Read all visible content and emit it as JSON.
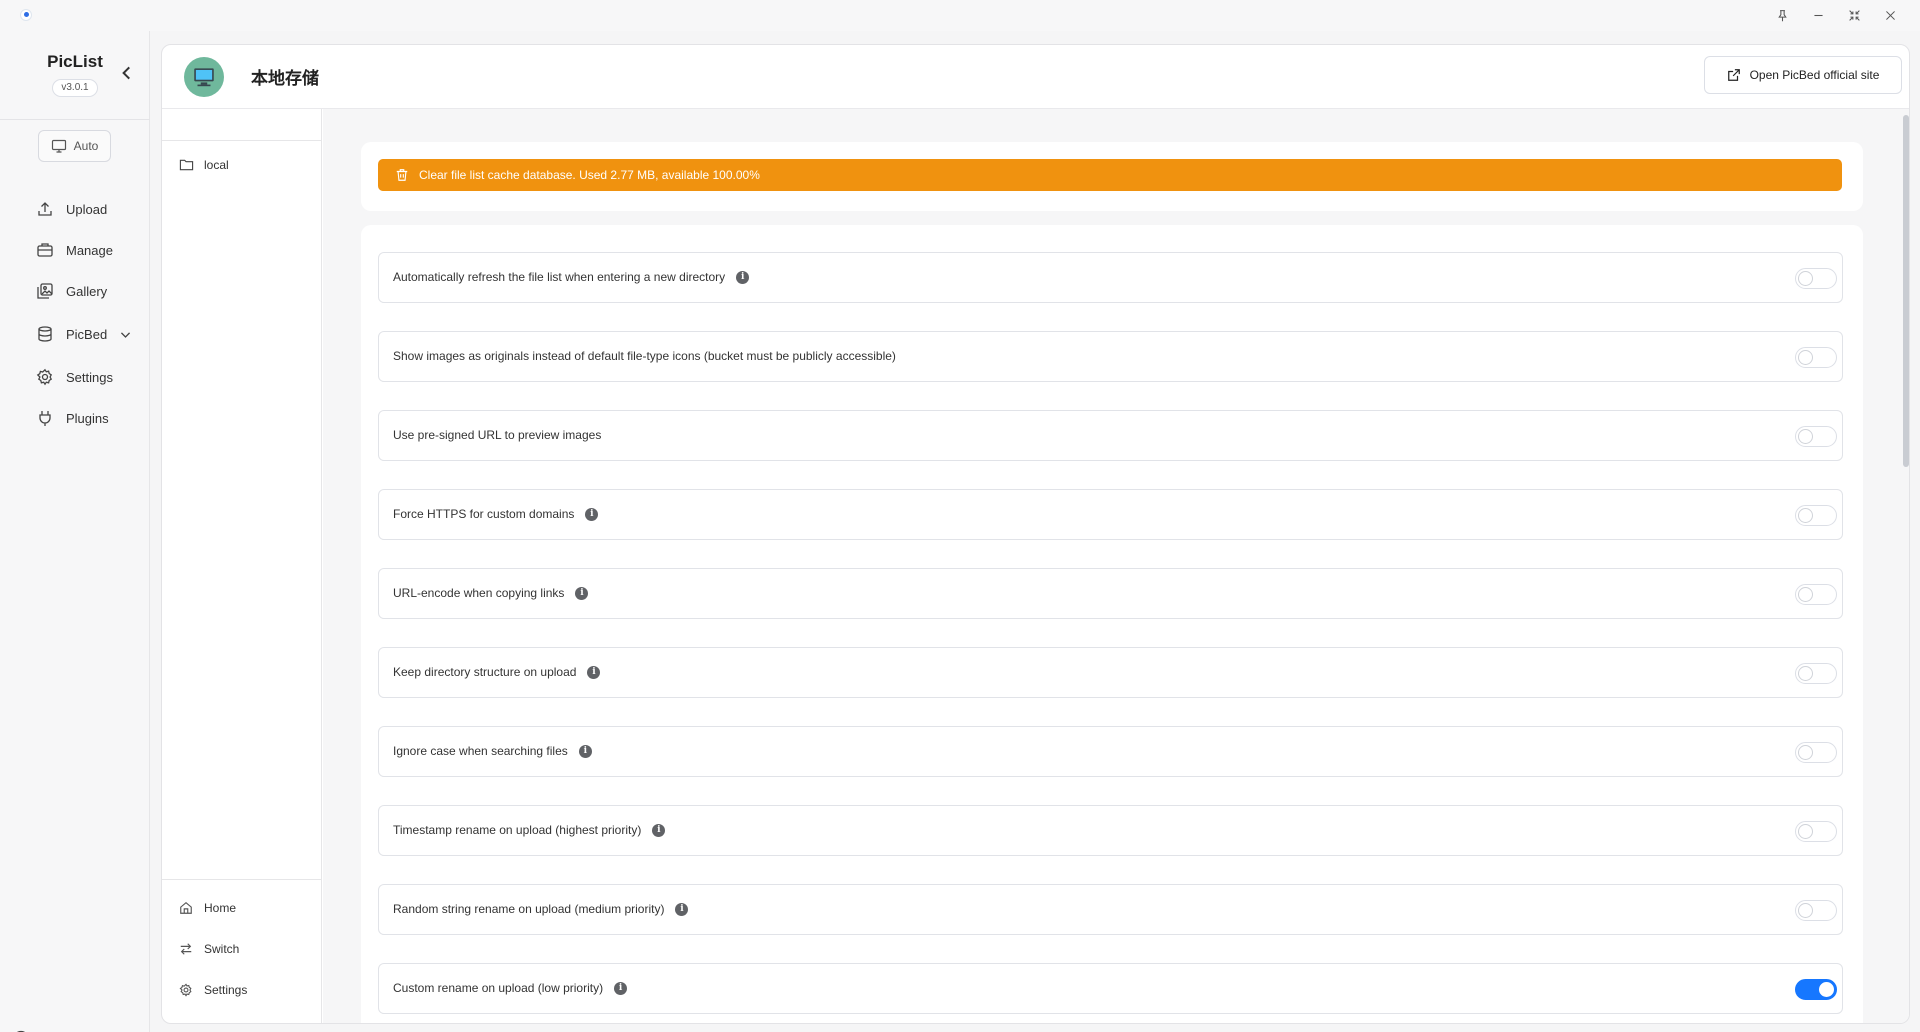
{
  "window": {
    "controls": [
      "pin-icon",
      "minimize-icon",
      "restore-icon",
      "close-icon"
    ]
  },
  "sidebar": {
    "brand": "PicList",
    "version": "v3.0.1",
    "mode_label": "Auto",
    "items": [
      {
        "label": "Upload",
        "icon": "upload-icon"
      },
      {
        "label": "Manage",
        "icon": "manage-icon"
      },
      {
        "label": "Gallery",
        "icon": "gallery-icon"
      },
      {
        "label": "PicBed",
        "icon": "database-icon"
      },
      {
        "label": "Settings",
        "icon": "gear-icon"
      },
      {
        "label": "Plugins",
        "icon": "plug-icon"
      }
    ]
  },
  "header": {
    "title": "本地存储",
    "open_site_label": "Open PicBed official site"
  },
  "folders": {
    "items": [
      {
        "label": "local"
      }
    ],
    "bottom_nav": [
      {
        "label": "Home",
        "icon": "home-icon"
      },
      {
        "label": "Switch",
        "icon": "switch-icon"
      },
      {
        "label": "Settings",
        "icon": "gear-icon"
      }
    ]
  },
  "cache": {
    "label": "Clear file list cache database. Used 2.77 MB, available 100.00%",
    "color": "#f0920f"
  },
  "settings": {
    "rows": [
      {
        "label": "Automatically refresh the file list when entering a new directory",
        "info": true,
        "on": false
      },
      {
        "label": "Show images as originals instead of default file-type icons (bucket must be publicly accessible)",
        "info": false,
        "on": false
      },
      {
        "label": "Use pre-signed URL to preview images",
        "info": false,
        "on": false
      },
      {
        "label": "Force HTTPS for custom domains",
        "info": true,
        "on": false
      },
      {
        "label": "URL-encode when copying links",
        "info": true,
        "on": false
      },
      {
        "label": "Keep directory structure on upload",
        "info": true,
        "on": false
      },
      {
        "label": "Ignore case when searching files",
        "info": true,
        "on": false
      },
      {
        "label": "Timestamp rename on upload (highest priority)",
        "info": true,
        "on": false
      },
      {
        "label": "Random string rename on upload (medium priority)",
        "info": true,
        "on": false
      },
      {
        "label": "Custom rename on upload (low priority)",
        "info": true,
        "on": true
      }
    ],
    "accent": "#1677ff"
  }
}
